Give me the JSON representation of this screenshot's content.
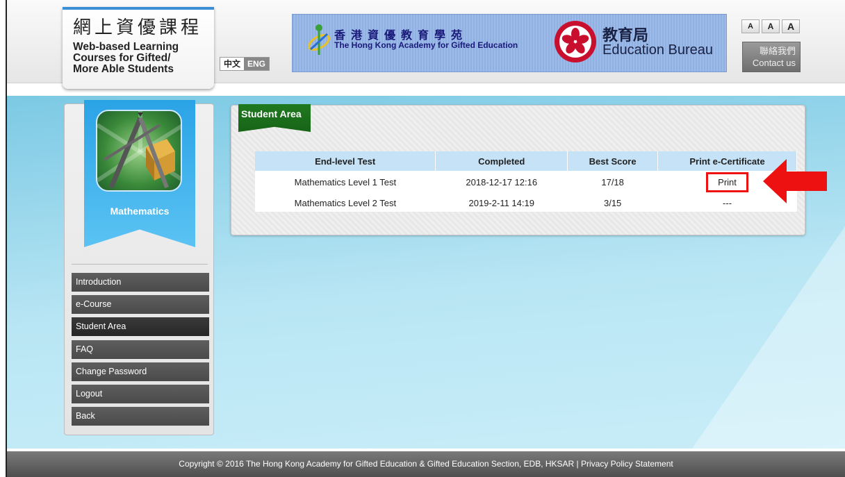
{
  "header": {
    "logo_cn": "網上資優課程",
    "logo_en_lines": [
      "Web-based Learning",
      "Courses for Gifted/",
      "More Able Students"
    ],
    "lang_zh": "中文",
    "lang_en": "ENG",
    "academy_cn": "香港資優教育學苑",
    "academy_en": "The Hong Kong Academy for Gifted Education",
    "edb_cn": "教育局",
    "edb_en": "Education Bureau",
    "font_buttons": [
      "A",
      "A",
      "A"
    ],
    "contact_cn": "聯絡我們",
    "contact_en": "Contact us"
  },
  "sidebar": {
    "course_title": "Mathematics",
    "course_icon": "geometry-tools-icon",
    "nav": [
      {
        "label": "Introduction",
        "active": false
      },
      {
        "label": "e-Course",
        "active": false
      },
      {
        "label": "Student Area",
        "active": true
      },
      {
        "label": "FAQ",
        "active": false
      },
      {
        "label": "Change Password",
        "active": false
      },
      {
        "label": "Logout",
        "active": false
      },
      {
        "label": "Back",
        "active": false
      }
    ]
  },
  "panel": {
    "tab_label": "Student Area",
    "columns": [
      "End-level Test",
      "Completed",
      "Best Score",
      "Print e-Certificate"
    ],
    "rows": [
      {
        "test": "Mathematics Level 1 Test",
        "completed": "2018-12-17 12:16",
        "score": "17/18",
        "print": "Print"
      },
      {
        "test": "Mathematics Level 2 Test",
        "completed": "2019-2-11 14:19",
        "score": "3/15",
        "print": "---"
      }
    ]
  },
  "annotation": {
    "arrow_icon": "red-arrow-icon",
    "highlight_color": "#ee1111"
  },
  "footer": {
    "text": "Copyright © 2016 The Hong Kong Academy for Gifted Education & Gifted Education Section, EDB, HKSAR | Privacy Policy Statement"
  }
}
